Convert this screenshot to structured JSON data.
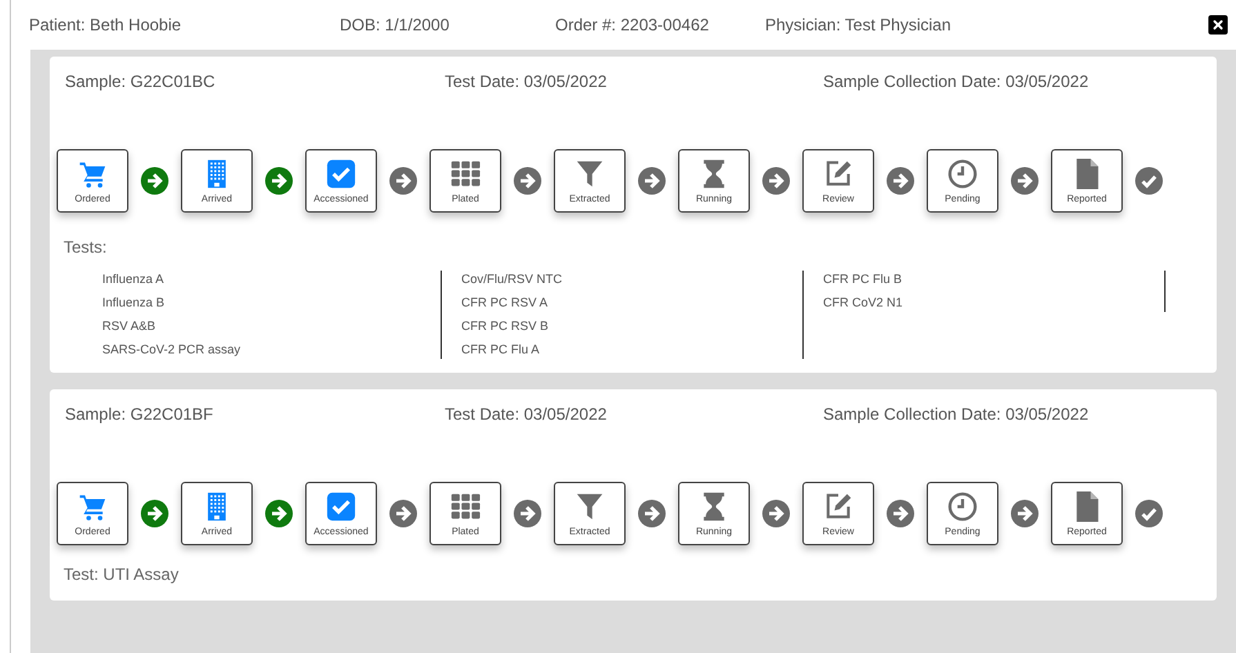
{
  "header": {
    "patient": "Patient: Beth Hoobie",
    "dob": "DOB: 1/1/2000",
    "order": "Order #: 2203-00462",
    "physician": "Physician: Test Physician"
  },
  "samples": [
    {
      "sample": "Sample: G22C01BC",
      "test_date": "Test Date: 03/05/2022",
      "collection_date": "Sample Collection Date: 03/05/2022",
      "steps": [
        {
          "kind": "cart",
          "label": "Ordered",
          "completed": true
        },
        {
          "kind": "building",
          "label": "Arrived",
          "completed": true
        },
        {
          "kind": "check",
          "label": "Accessioned",
          "completed": true
        },
        {
          "kind": "grid",
          "label": "Plated",
          "completed": false
        },
        {
          "kind": "filter",
          "label": "Extracted",
          "completed": false
        },
        {
          "kind": "hourglass",
          "label": "Running",
          "completed": false
        },
        {
          "kind": "edit",
          "label": "Review",
          "completed": false
        },
        {
          "kind": "clock",
          "label": "Pending",
          "completed": false
        },
        {
          "kind": "file",
          "label": "Reported",
          "completed": false
        }
      ],
      "tests_label": "Tests:",
      "test_columns": [
        [
          "Influenza A",
          "Influenza B",
          "RSV A&B",
          "SARS-CoV-2 PCR assay"
        ],
        [
          "Cov/Flu/RSV NTC",
          "CFR PC RSV A",
          "CFR PC RSV B",
          "CFR PC Flu A"
        ],
        [
          "CFR PC Flu B",
          "CFR CoV2 N1"
        ]
      ]
    },
    {
      "sample": "Sample: G22C01BF",
      "test_date": "Test Date: 03/05/2022",
      "collection_date": "Sample Collection Date: 03/05/2022",
      "steps": [
        {
          "kind": "cart",
          "label": "Ordered",
          "completed": true
        },
        {
          "kind": "building",
          "label": "Arrived",
          "completed": true
        },
        {
          "kind": "check",
          "label": "Accessioned",
          "completed": true
        },
        {
          "kind": "grid",
          "label": "Plated",
          "completed": false
        },
        {
          "kind": "filter",
          "label": "Extracted",
          "completed": false
        },
        {
          "kind": "hourglass",
          "label": "Running",
          "completed": false
        },
        {
          "kind": "edit",
          "label": "Review",
          "completed": false
        },
        {
          "kind": "clock",
          "label": "Pending",
          "completed": false
        },
        {
          "kind": "file",
          "label": "Reported",
          "completed": false
        }
      ],
      "test_single": "Test: UTI Assay"
    }
  ]
}
